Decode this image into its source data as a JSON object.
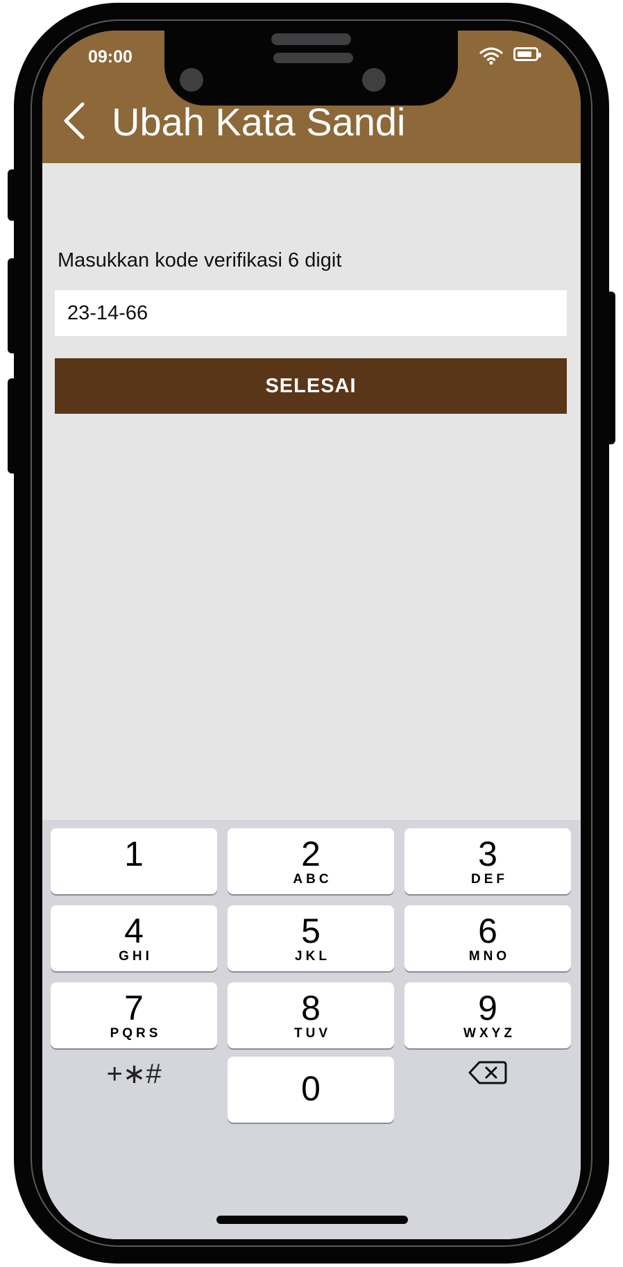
{
  "status_bar": {
    "time": "09:00"
  },
  "header": {
    "title": "Ubah Kata Sandi"
  },
  "form": {
    "label": "Masukkan kode verifikasi 6 digit",
    "code_value": "23-14-66",
    "submit_label": "SELESAI"
  },
  "keypad": {
    "keys": [
      {
        "digit": "1",
        "letters": ""
      },
      {
        "digit": "2",
        "letters": "ABC"
      },
      {
        "digit": "3",
        "letters": "DEF"
      },
      {
        "digit": "4",
        "letters": "GHI"
      },
      {
        "digit": "5",
        "letters": "JKL"
      },
      {
        "digit": "6",
        "letters": "MNO"
      },
      {
        "digit": "7",
        "letters": "PQRS"
      },
      {
        "digit": "8",
        "letters": "TUV"
      },
      {
        "digit": "9",
        "letters": "WXYZ"
      },
      {
        "digit": "0",
        "letters": ""
      }
    ],
    "symbols": "+∗#"
  },
  "colors": {
    "header": "#8d6838",
    "button": "#5a3619",
    "background": "#e5e5e5",
    "keypad": "#d4d6db"
  }
}
